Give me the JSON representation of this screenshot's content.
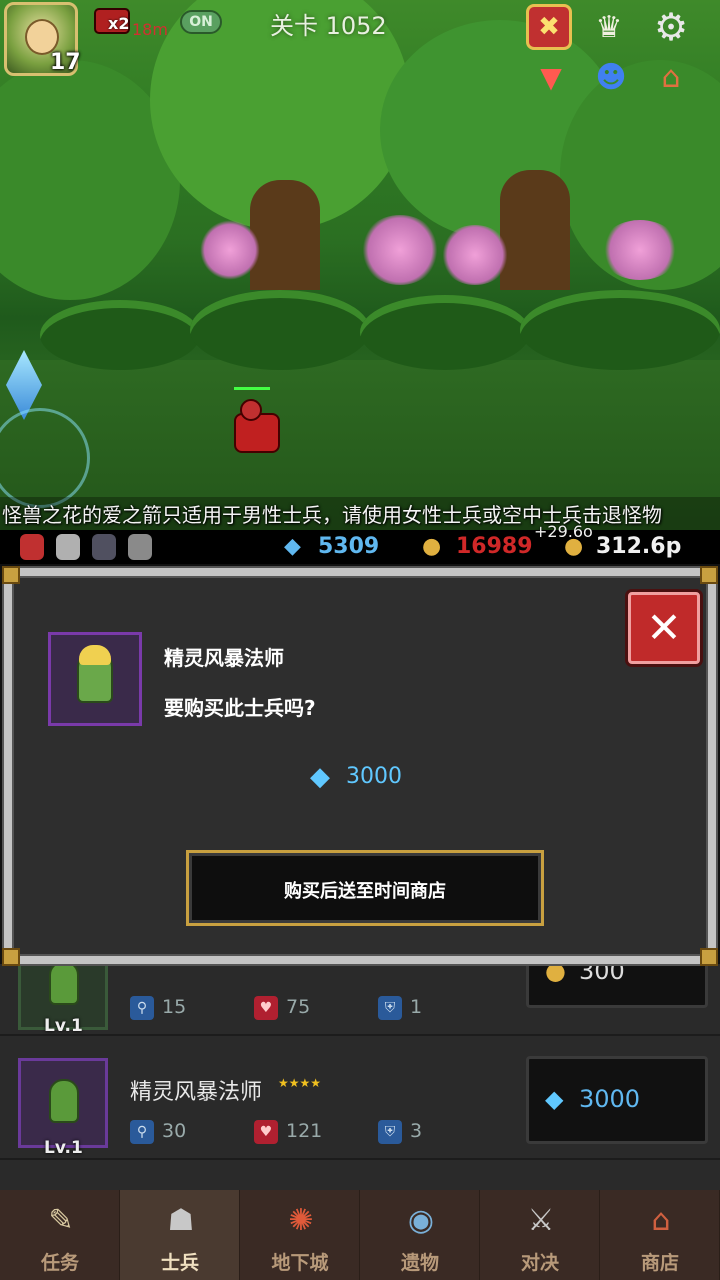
{
  "hud": {
    "hero_level": "17",
    "speed": "x2",
    "time": "18m",
    "auto": "ON",
    "stage": "关卡 1052"
  },
  "hint": "怪兽之花的爱之箭只适用于男性士兵，请使用女性士兵或空中士兵击退怪物",
  "resources": {
    "gems": "5309",
    "medals": "16989",
    "gold": "312.6p",
    "gold_rate": "+29.6o"
  },
  "dialog": {
    "unit_name": "精灵风暴法师",
    "question": "要购买此士兵吗?",
    "price": "3000",
    "buy_label": "购买后送至时间商店",
    "close_label": "✕"
  },
  "list": {
    "rows": [
      {
        "name": "",
        "level": "Lv.1",
        "atk": "15",
        "hp": "75",
        "def": "1",
        "price": "300"
      },
      {
        "name": "精灵风暴法师",
        "stars": "★★★★",
        "level": "Lv.1",
        "atk": "30",
        "hp": "121",
        "def": "3",
        "price": "3000"
      }
    ]
  },
  "tabs": [
    {
      "label": "任务"
    },
    {
      "label": "士兵"
    },
    {
      "label": "地下城"
    },
    {
      "label": "遗物"
    },
    {
      "label": "对决"
    },
    {
      "label": "商店"
    }
  ],
  "colors": {
    "gem": "#60b8f0",
    "medal": "#d02828",
    "close": "#c02a2a",
    "frame": "#c4c4c4"
  }
}
